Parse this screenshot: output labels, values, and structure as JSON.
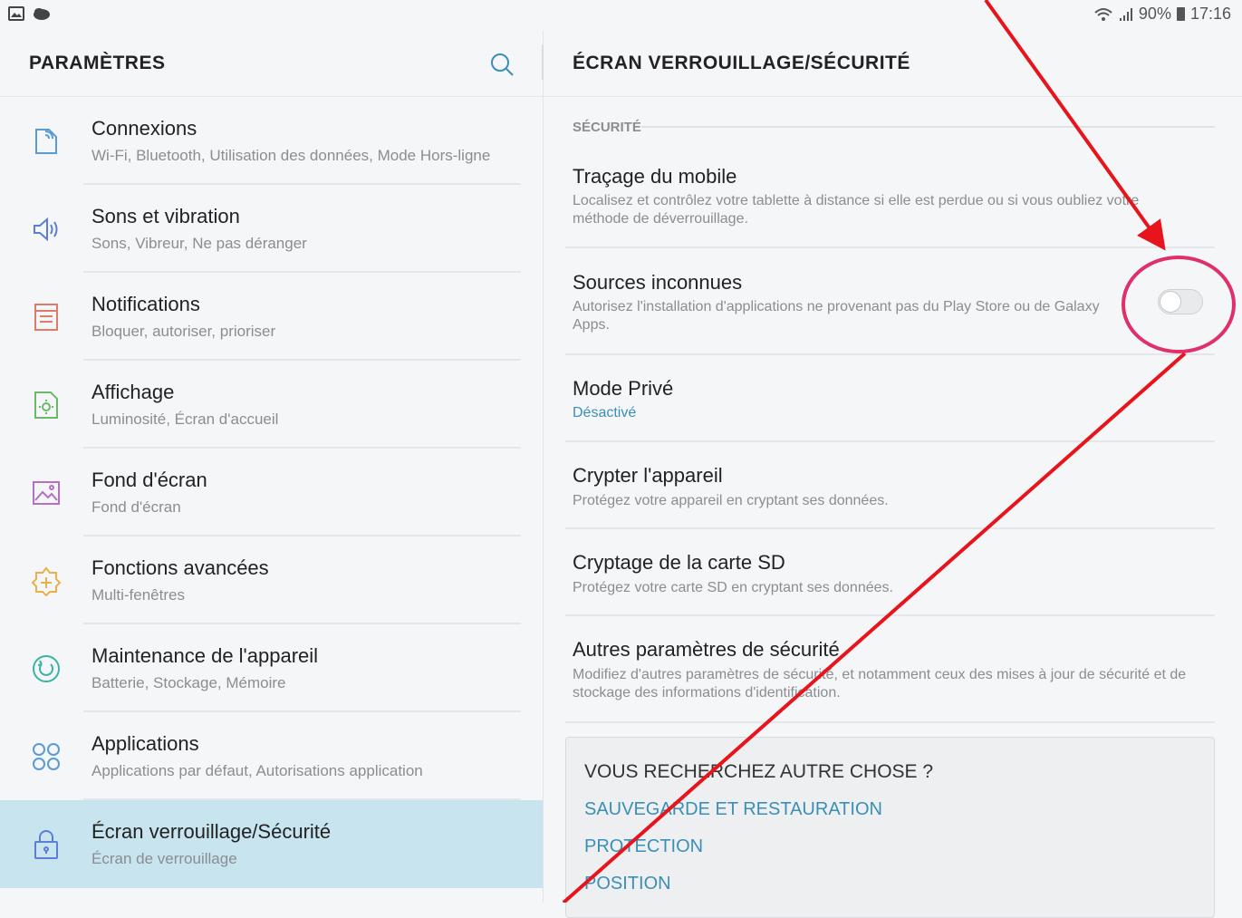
{
  "status_bar": {
    "left_icons": [
      "image-icon",
      "cloud-icon"
    ],
    "right_icons": [
      "wifi-icon",
      "signal-icon",
      "battery-icon"
    ],
    "battery": "90%",
    "time": "17:16"
  },
  "left_pane": {
    "title": "PARAMÈTRES",
    "search_icon": "search-icon",
    "items": [
      {
        "title": "Connexions",
        "subtitle": "Wi-Fi, Bluetooth, Utilisation des données, Mode Hors-ligne",
        "icon": "connections-icon",
        "color": "#5b9bd5"
      },
      {
        "title": "Sons et vibration",
        "subtitle": "Sons, Vibreur, Ne pas déranger",
        "icon": "sound-icon",
        "color": "#5b7fd5"
      },
      {
        "title": "Notifications",
        "subtitle": "Bloquer, autoriser, prioriser",
        "icon": "notifications-icon",
        "color": "#e07b6a"
      },
      {
        "title": "Affichage",
        "subtitle": "Luminosité, Écran d'accueil",
        "icon": "display-icon",
        "color": "#6cb86a"
      },
      {
        "title": "Fond d'écran",
        "subtitle": "Fond d'écran",
        "icon": "wallpaper-icon",
        "color": "#b56fc4"
      },
      {
        "title": "Fonctions avancées",
        "subtitle": "Multi-fenêtres",
        "icon": "advanced-features-icon",
        "color": "#e8b04a"
      },
      {
        "title": "Maintenance de l'appareil",
        "subtitle": "Batterie, Stockage, Mémoire",
        "icon": "device-maintenance-icon",
        "color": "#3bb3a6"
      },
      {
        "title": "Applications",
        "subtitle": "Applications par défaut, Autorisations application",
        "icon": "apps-icon",
        "color": "#5b9bd5"
      },
      {
        "title": "Écran verrouillage/Sécurité",
        "subtitle": "Écran de verrouillage",
        "icon": "lock-icon",
        "color": "#5b7fd5",
        "selected": true
      }
    ]
  },
  "right_pane": {
    "title": "ÉCRAN VERROUILLAGE/SÉCURITÉ",
    "section_label": "SÉCURITÉ",
    "items": [
      {
        "title": "Traçage du mobile",
        "subtitle": "Localisez et contrôlez votre tablette à distance si elle est perdue ou si vous oubliez votre méthode de déverrouillage."
      },
      {
        "title": "Sources inconnues",
        "subtitle": "Autorisez l'installation d'applications ne provenant pas du Play Store ou de Galaxy Apps.",
        "toggle": false
      },
      {
        "title": "Mode Privé",
        "subtitle": "Désactivé"
      },
      {
        "title": "Crypter l'appareil",
        "subtitle": "Protégez votre appareil en cryptant ses données."
      },
      {
        "title": "Cryptage de la carte SD",
        "subtitle": "Protégez votre carte SD en cryptant ses données."
      },
      {
        "title": "Autres paramètres de sécurité",
        "subtitle": "Modifiez d'autres paramètres de sécurité, et notamment ceux des mises à jour de sécurité et de stockage des informations d'identification."
      }
    ],
    "suggestions": {
      "title": "VOUS RECHERCHEZ AUTRE CHOSE ?",
      "links": [
        "SAUVEGARDE ET RESTAURATION",
        "PROTECTION",
        "POSITION"
      ]
    }
  },
  "annotation": {
    "color": "#e8141c",
    "circle_color": "#e0306a"
  }
}
